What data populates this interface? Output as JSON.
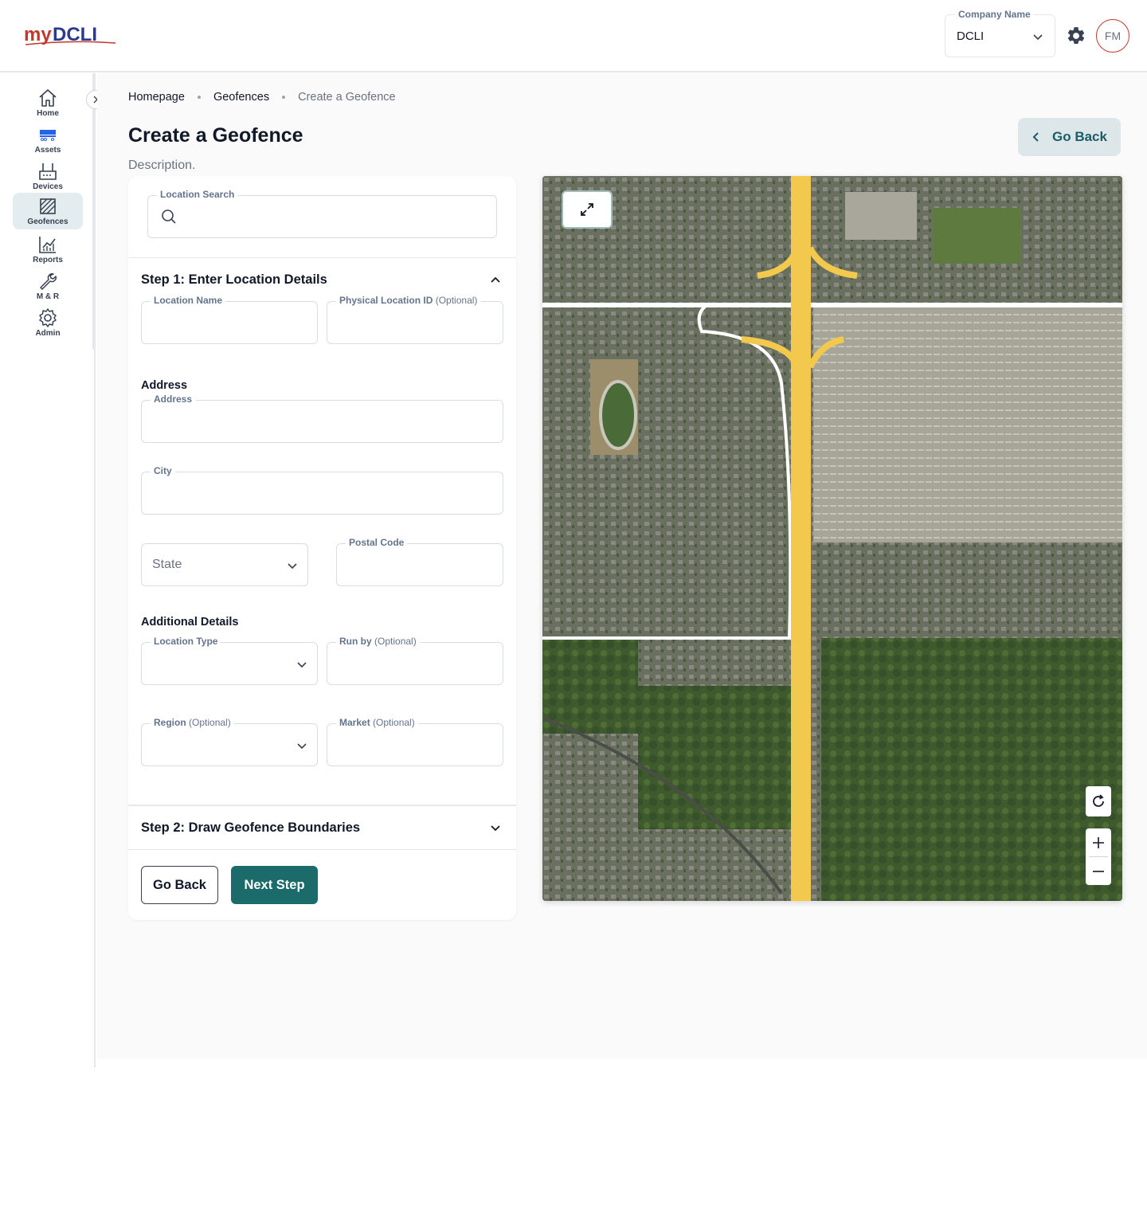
{
  "header": {
    "logo_text": "myDCLI",
    "company": {
      "label": "Company Name",
      "value": "DCLI"
    },
    "avatar_initials": "FM",
    "colors": {
      "brand_red": "#c0392b",
      "accent_teal": "#1a6b6a"
    }
  },
  "sidebar": {
    "items": [
      {
        "label": "Home",
        "icon": "home-icon"
      },
      {
        "label": "Assets",
        "icon": "chassis-icon"
      },
      {
        "label": "Devices",
        "icon": "router-icon"
      },
      {
        "label": "Geofences",
        "icon": "geofence-icon",
        "active": true
      },
      {
        "label": "Reports",
        "icon": "chart-icon"
      },
      {
        "label": "M & R",
        "icon": "wrench-icon"
      },
      {
        "label": "Admin",
        "icon": "gear-icon"
      }
    ]
  },
  "breadcrumb": [
    "Homepage",
    "Geofences",
    "Create a Geofence"
  ],
  "page": {
    "title": "Create a Geofence",
    "description": "Description.",
    "go_back": "Go Back"
  },
  "form": {
    "location_search": {
      "label": "Location Search",
      "value": ""
    },
    "step1": {
      "title": "Step 1: Enter Location Details",
      "location_name": {
        "label": "Location Name",
        "value": ""
      },
      "physical_location_id": {
        "label": "Physical Location ID",
        "optional": "(Optional)",
        "value": ""
      },
      "address_section": "Address",
      "address": {
        "label": "Address",
        "value": ""
      },
      "city": {
        "label": "City",
        "value": ""
      },
      "state": {
        "placeholder": "State"
      },
      "postal_code": {
        "label": "Postal Code",
        "value": ""
      },
      "additional_section": "Additional Details",
      "location_type": {
        "label": "Location Type",
        "value": ""
      },
      "run_by": {
        "label": "Run by",
        "optional": "(Optional)",
        "value": ""
      },
      "region": {
        "label": "Region",
        "optional": "(Optional)",
        "value": ""
      },
      "market": {
        "label": "Market",
        "optional": "(Optional)",
        "value": ""
      }
    },
    "step2": {
      "title": "Step 2: Draw Geofence Boundaries"
    },
    "buttons": {
      "back": "Go Back",
      "next": "Next Step"
    }
  },
  "map": {
    "view": "satellite",
    "controls": [
      "expand-icon",
      "refresh-icon",
      "zoom-in-icon",
      "zoom-out-icon"
    ]
  }
}
